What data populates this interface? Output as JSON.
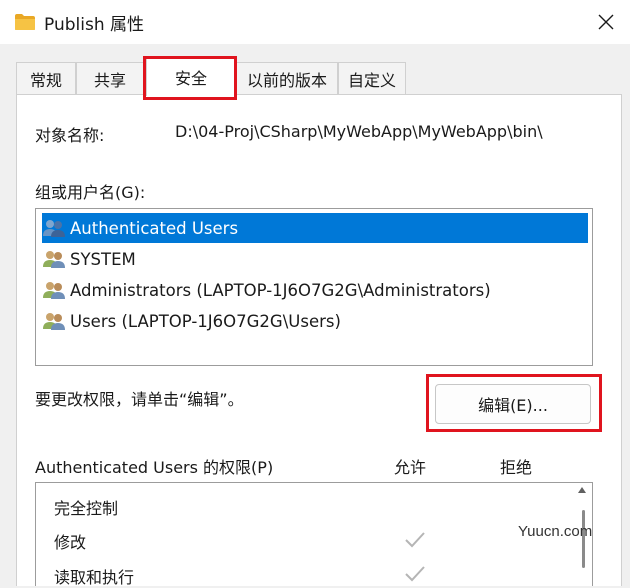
{
  "window": {
    "title": "Publish 属性",
    "icon": "folder-icon",
    "close_icon": "close-icon"
  },
  "tabs": [
    {
      "label": "常规",
      "active": false
    },
    {
      "label": "共享",
      "active": false
    },
    {
      "label": "安全",
      "active": true
    },
    {
      "label": "以前的版本",
      "active": false
    },
    {
      "label": "自定义",
      "active": false
    }
  ],
  "security": {
    "object_name_label": "对象名称:",
    "object_path": "D:\\04-Proj\\CSharp\\MyWebApp\\MyWebApp\\bin\\",
    "groups_label": "组或用户名(G):",
    "users": [
      {
        "name": "Authenticated Users",
        "selected": true
      },
      {
        "name": "SYSTEM",
        "selected": false
      },
      {
        "name": "Administrators (LAPTOP-1J6O7G2G\\Administrators)",
        "selected": false
      },
      {
        "name": "Users (LAPTOP-1J6O7G2G\\Users)",
        "selected": false
      }
    ],
    "change_hint": "要更改权限，请单击“编辑”。",
    "edit_button": "编辑(E)...",
    "permissions_label": "Authenticated Users 的权限(P)",
    "allow_header": "允许",
    "deny_header": "拒绝",
    "permissions": [
      {
        "name": "完全控制",
        "allow": false
      },
      {
        "name": "修改",
        "allow": true
      },
      {
        "name": "读取和执行",
        "allow": true
      }
    ]
  },
  "watermark": "Yuucn.com",
  "colors": {
    "selection": "#0078d7",
    "highlight_box": "#e0141e",
    "folder": "#f6c344"
  }
}
